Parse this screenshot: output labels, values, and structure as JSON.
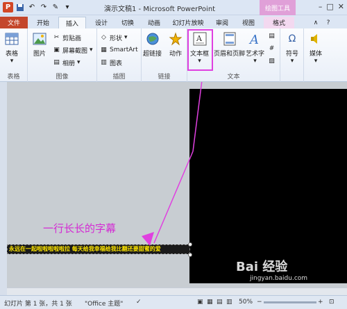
{
  "window": {
    "title": "演示文稿1 - Microsoft PowerPoint",
    "context_tab_group": "绘图工具"
  },
  "tabs": [
    "文件",
    "开始",
    "插入",
    "设计",
    "切换",
    "动画",
    "幻灯片放映",
    "审阅",
    "视图",
    "格式"
  ],
  "ribbon": {
    "tables": {
      "btn": "表格",
      "label": "表格"
    },
    "images": {
      "picture": "图片",
      "clipart": "剪贴画",
      "screenshot": "屏幕截图",
      "album": "相册",
      "label": "图像"
    },
    "illustrations": {
      "shapes": "形状",
      "smartart": "SmartArt",
      "chart": "图表",
      "label": "插图"
    },
    "links": {
      "hyperlink": "超链接",
      "action": "动作",
      "label": "链接"
    },
    "text": {
      "textbox": "文本框",
      "header_footer": "页眉和页脚",
      "wordart": "艺术字",
      "label": "文本"
    },
    "symbols": {
      "symbol": "符号"
    },
    "media": {
      "media": "媒体"
    }
  },
  "canvas": {
    "caption": "一行长长的字幕",
    "subtitle_text": "永远在一起啦啦啦啦啦拉 每天给我幸福给我比翻还要甜蜜的爱"
  },
  "statusbar": {
    "slide_info": "幻灯片 第 1 张，共 1 张",
    "theme": "\"Office 主题\"",
    "zoom": "50%"
  },
  "watermark": {
    "brand": "Bai 经验",
    "url": "jingyan.baidu.com"
  },
  "colors": {
    "file_tab": "#c4462b",
    "highlight": "#e040e0",
    "caption": "#d42ad4",
    "subtitle": "#ffe600"
  }
}
